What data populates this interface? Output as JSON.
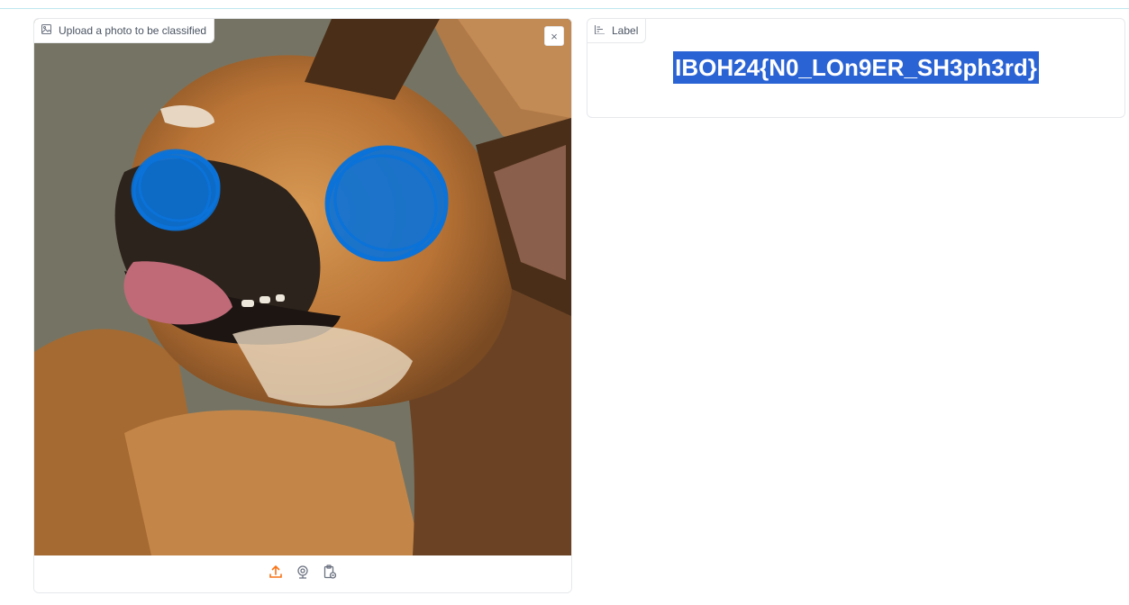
{
  "upload": {
    "label": "Upload a photo to be classified",
    "close_symbol": "×",
    "icons": {
      "image": "image-icon",
      "close": "close-icon",
      "upload": "upload-icon",
      "webcam": "webcam-icon",
      "clipboard": "clipboard-icon"
    },
    "colors": {
      "accent": "#f97316",
      "scribble": "#0a72d8"
    }
  },
  "label_panel": {
    "label": "Label",
    "prediction": "IBOH24{N0_LOn9ER_SH3ph3rd}",
    "icon": "bar-chart-icon",
    "highlight_color": "#2a63d4"
  }
}
